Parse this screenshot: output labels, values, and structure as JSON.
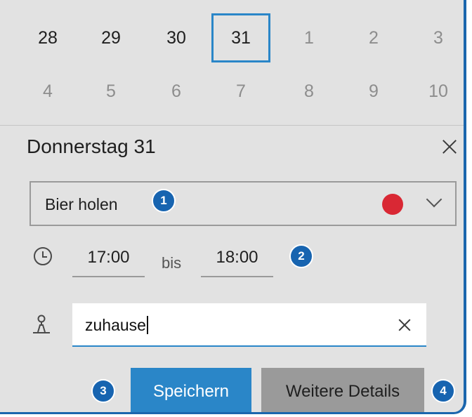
{
  "calendar": {
    "week1": [
      "28",
      "29",
      "30",
      "31",
      "1",
      "2",
      "3"
    ],
    "week2": [
      "4",
      "5",
      "6",
      "7",
      "8",
      "9",
      "10"
    ]
  },
  "event": {
    "date_title": "Donnerstag 31",
    "title": "Bier holen",
    "color": "#d92834",
    "start_time": "17:00",
    "between_label": "bis",
    "end_time": "18:00",
    "location": "zuhause"
  },
  "buttons": {
    "save": "Speichern",
    "more_details": "Weitere Details"
  },
  "badges": [
    "1",
    "2",
    "3",
    "4"
  ],
  "colors": {
    "accent": "#2a86c8",
    "badge": "#1764b0",
    "panel_bg": "#e2e2e2"
  }
}
